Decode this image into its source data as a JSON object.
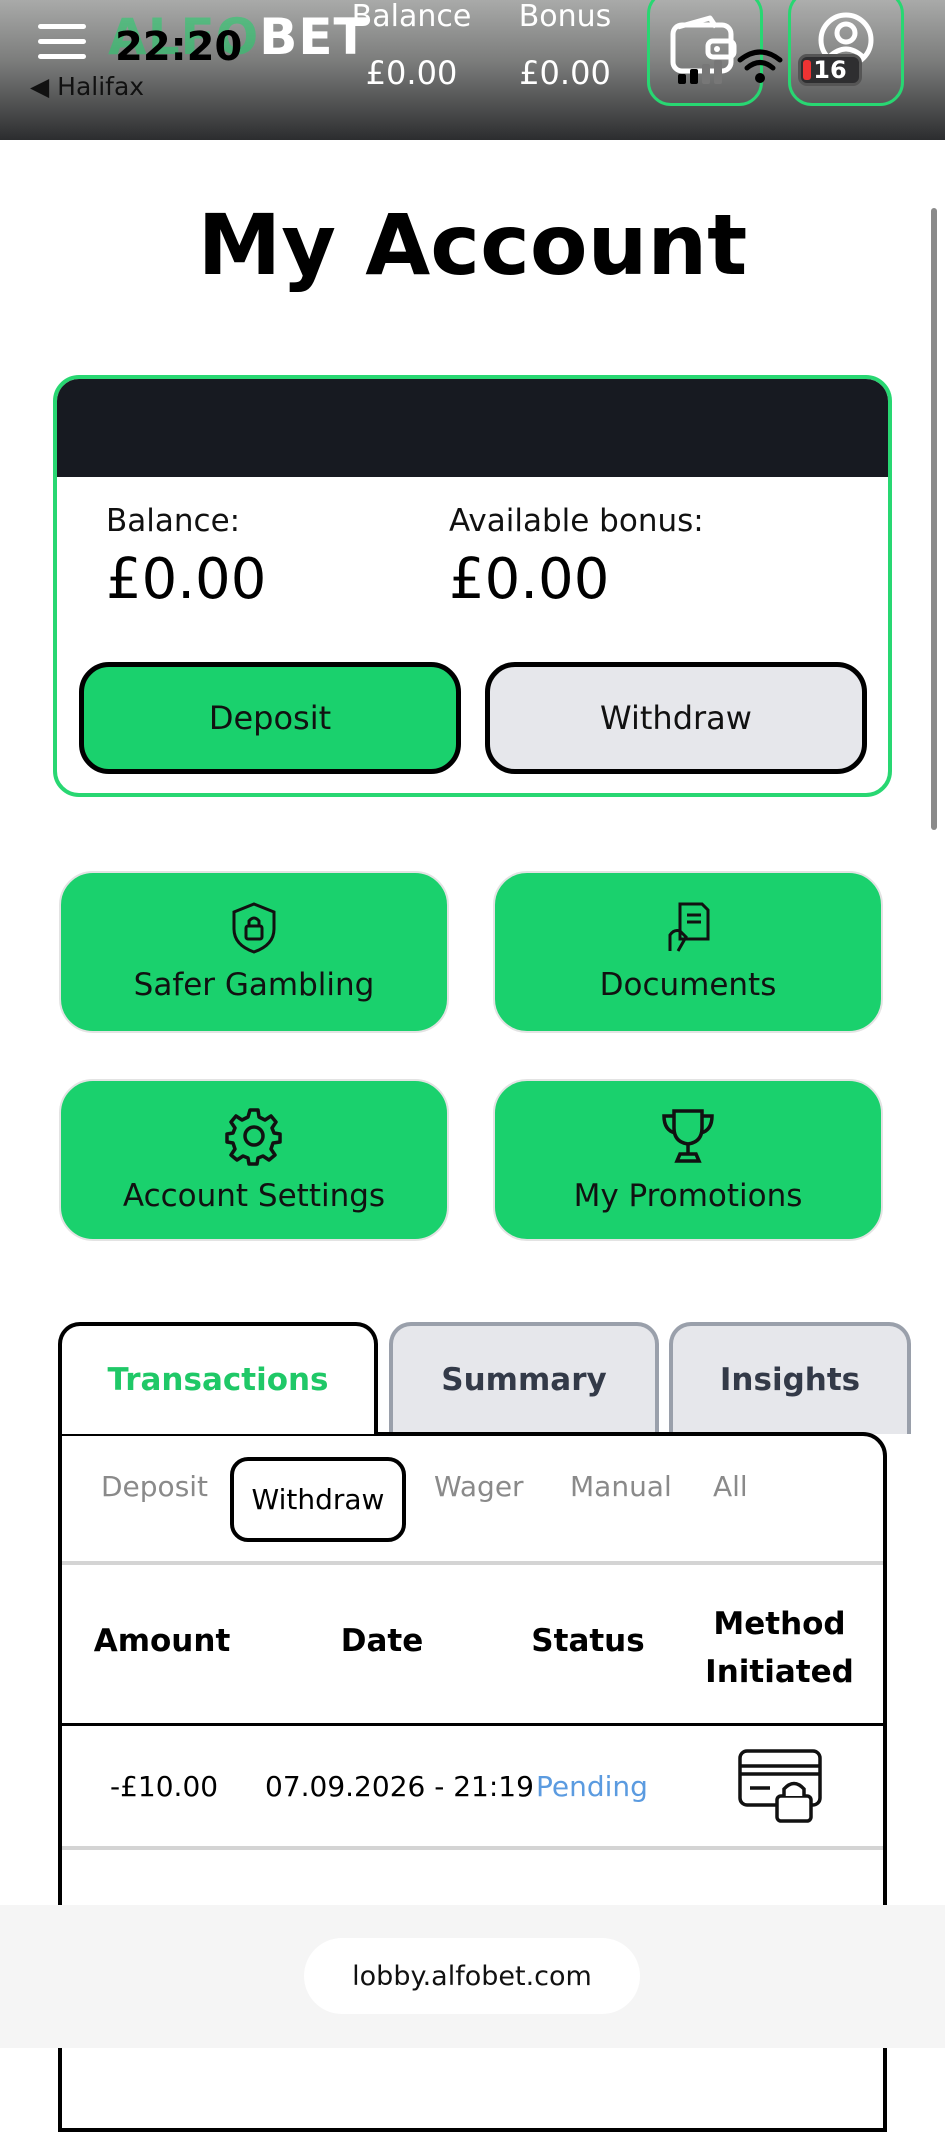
{
  "status_bar": {
    "time": "22:20",
    "back_app": "◀ Halifax",
    "battery": "16"
  },
  "header": {
    "logo_green": "ALFO",
    "logo_white": "BET",
    "balance_label": "Balance",
    "balance_value": "£0.00",
    "bonus_label": "Bonus",
    "bonus_value": "£0.00",
    "icons": [
      "menu-icon",
      "wallet-icon",
      "user-icon"
    ]
  },
  "page": {
    "title": "My Account"
  },
  "card": {
    "balance_label": "Balance:",
    "balance_value": "£0.00",
    "bonus_label": "Available bonus:",
    "bonus_value": "£0.00",
    "deposit_label": "Deposit",
    "withdraw_label": "Withdraw"
  },
  "tiles": [
    {
      "label": "Safer Gambling",
      "icon": "shield-lock-icon"
    },
    {
      "label": "Documents",
      "icon": "document-icon"
    },
    {
      "label": "Account Settings",
      "icon": "gear-icon"
    },
    {
      "label": "My Promotions",
      "icon": "trophy-icon"
    }
  ],
  "tabs": [
    "Transactions",
    "Summary",
    "Insights"
  ],
  "subtabs": [
    "Deposit",
    "Withdraw",
    "Wager",
    "Manual",
    "All"
  ],
  "table": {
    "headers": {
      "amount": "Amount",
      "date": "Date",
      "status": "Status",
      "method_1": "Method",
      "method_2": "Initiated"
    },
    "rows": [
      {
        "amount": "-£10.00",
        "date": "07.09.2026 - 21:19",
        "status": "Pending",
        "method_icon": "card-lock-icon"
      }
    ]
  },
  "browser": {
    "url": "lobby.alfobet.com"
  },
  "colors": {
    "accent": "#1ad16d",
    "dark": "#171a21",
    "status_pending": "#5b9be0"
  }
}
